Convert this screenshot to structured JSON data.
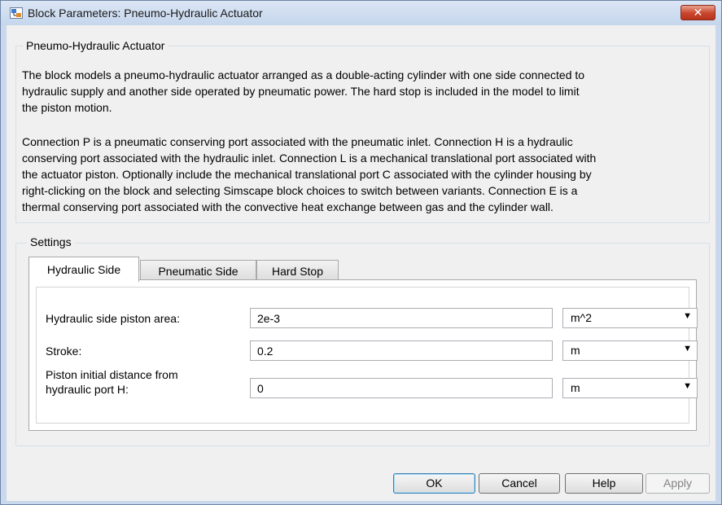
{
  "window": {
    "title": "Block Parameters: Pneumo-Hydraulic Actuator",
    "close_glyph": "✕"
  },
  "block": {
    "group_title": "Pneumo-Hydraulic Actuator",
    "description_lines_1": [
      "The block models a pneumo-hydraulic actuator arranged as a double-acting cylinder with one side connected to",
      "hydraulic supply and another side operated by pneumatic power. The hard stop is included in the model to limit",
      "the piston motion."
    ],
    "description_lines_2": [
      "Connection P is a pneumatic conserving port associated with the pneumatic inlet. Connection H is a hydraulic",
      "conserving port associated with the hydraulic inlet. Connection L is a mechanical translational port associated with",
      "the actuator piston. Optionally include the mechanical translational port C associated with the cylinder housing by",
      "right-clicking on the block and selecting Simscape block choices to switch between variants. Connection E is a",
      "thermal conserving port associated with the convective heat exchange between gas and the cylinder wall."
    ]
  },
  "settings": {
    "group_title": "Settings",
    "tabs": [
      "Hydraulic Side",
      "Pneumatic Side",
      "Hard Stop"
    ],
    "active_tab": "Hydraulic Side",
    "params": [
      {
        "label": "Hydraulic side piston area:",
        "value": "2e-3",
        "unit": "m^2"
      },
      {
        "label": "Stroke:",
        "value": "0.2",
        "unit": "m"
      },
      {
        "label_lines": [
          "Piston initial distance from",
          "hydraulic port H:"
        ],
        "value": "0",
        "unit": "m"
      }
    ]
  },
  "buttons": {
    "ok": "OK",
    "cancel": "Cancel",
    "help": "Help",
    "apply": "Apply"
  },
  "icons": {
    "dropdown": "▼"
  },
  "colors": {
    "titlebar": "#c5d6ec",
    "close_button": "#c8452c",
    "dialog_background": "#f0f0f0",
    "default_button_border": "#3c7fb1"
  }
}
